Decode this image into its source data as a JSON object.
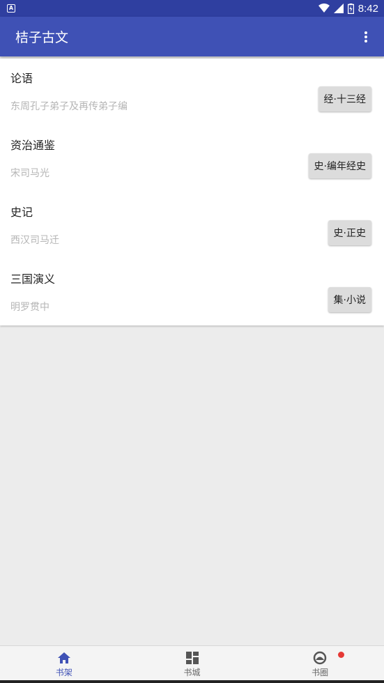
{
  "status_bar": {
    "left_icon": "A",
    "time": "8:42"
  },
  "app_bar": {
    "title": "桔子古文",
    "menu_icon": "more-vert-icon"
  },
  "books": [
    {
      "title": "论语",
      "author": "东周孔子弟子及再传弟子编",
      "category": "经·十三经"
    },
    {
      "title": "资治通鉴",
      "author": "宋司马光",
      "category": "史·编年经史"
    },
    {
      "title": "史记",
      "author": "西汉司马迁",
      "category": "史·正史"
    },
    {
      "title": "三国演义",
      "author": "明罗贯中",
      "category": "集·小说"
    }
  ],
  "bottom_nav": {
    "items": [
      {
        "label": "书架",
        "icon": "home-icon",
        "active": true
      },
      {
        "label": "书城",
        "icon": "dashboard-icon",
        "active": false
      },
      {
        "label": "书圈",
        "icon": "circle-icon",
        "active": false,
        "badge": true
      }
    ]
  },
  "colors": {
    "primary": "#3f51b5",
    "status_bar": "#2f3fa0",
    "badge": "#e53935",
    "background": "#ececec"
  }
}
